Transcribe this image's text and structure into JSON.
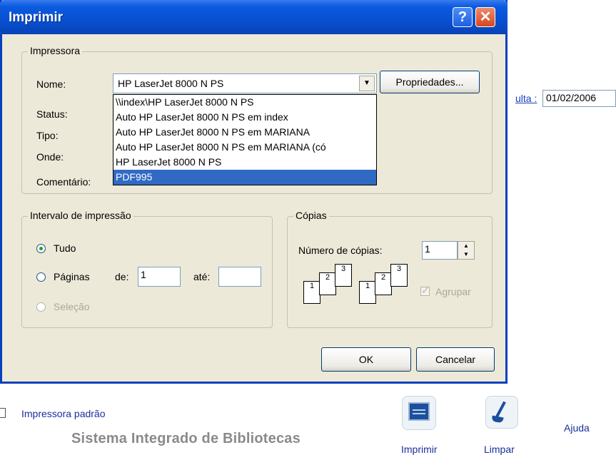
{
  "background": {
    "consulta_link": "ulta :",
    "date_value": "01/02/2006",
    "default_printer_label": "Impressora padrão",
    "system_name": "Sistema Integrado de Bibliotecas",
    "imprimir_label": "Imprimir",
    "limpar_label": "Limpar",
    "ajuda_label": "Ajuda"
  },
  "dialog": {
    "title": "Imprimir",
    "help_glyph": "?",
    "close_glyph": "✕",
    "printer_group": {
      "legend": "Impressora",
      "name_label": "Nome:",
      "status_label": "Status:",
      "type_label": "Tipo:",
      "where_label": "Onde:",
      "comment_label": "Comentário:",
      "selected_printer": "HP LaserJet 8000 N PS",
      "properties_button": "Propriedades...",
      "dropdown_options": [
        "\\\\index\\HP LaserJet 8000 N PS",
        "Auto HP LaserJet 8000 N PS em index",
        "Auto HP LaserJet 8000 N PS em MARIANA",
        "Auto HP LaserJet 8000 N PS em MARIANA (có",
        "HP LaserJet 8000 N PS",
        "PDF995"
      ],
      "highlighted_option": "PDF995"
    },
    "range_group": {
      "legend": "Intervalo de impressão",
      "all_label": "Tudo",
      "pages_label": "Páginas",
      "from_label": "de:",
      "from_value": "1",
      "to_label": "até:",
      "to_value": "",
      "selection_label": "Seleção"
    },
    "copies_group": {
      "legend": "Cópias",
      "copies_label": "Número de cópias:",
      "copies_value": "1",
      "collate_label": "Agrupar",
      "page_numbers": [
        "1",
        "2",
        "3"
      ]
    },
    "ok_button": "OK",
    "cancel_button": "Cancelar"
  }
}
